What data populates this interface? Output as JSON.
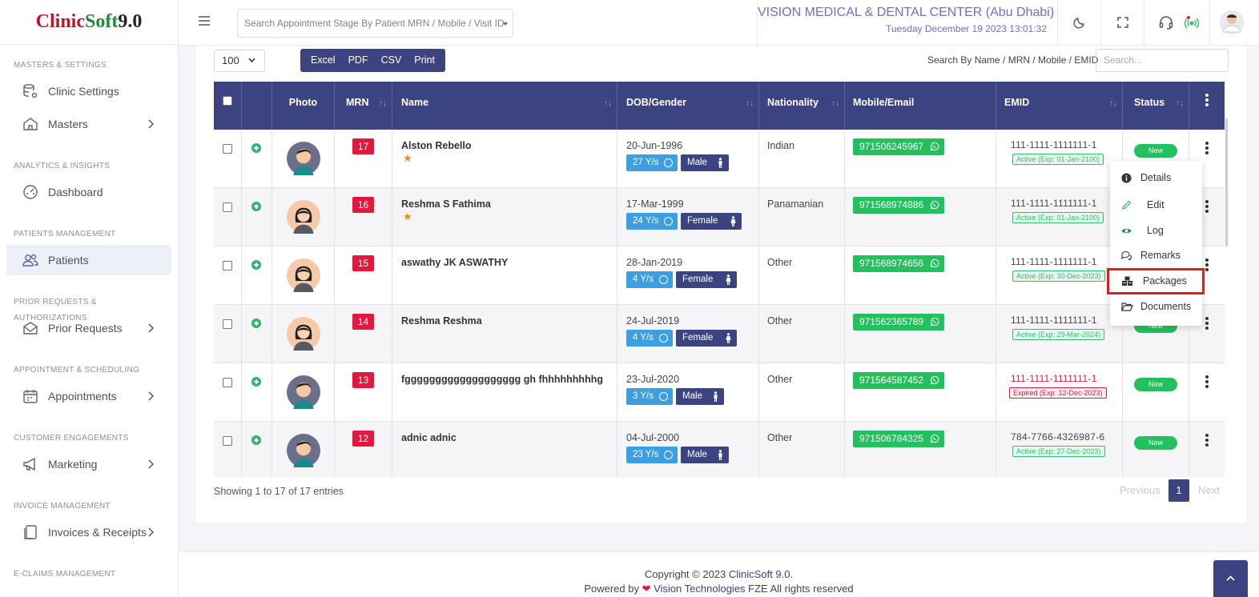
{
  "brand": {
    "part1": "Clinic",
    "part2": "Soft",
    "part3": " 9.0"
  },
  "sidebar": {
    "sections": [
      {
        "title": "MASTERS & SETTINGS",
        "items": [
          {
            "label": "Clinic Settings"
          },
          {
            "label": "Masters"
          }
        ]
      },
      {
        "title": "ANALYTICS & INSIGHTS",
        "items": [
          {
            "label": "Dashboard"
          }
        ]
      },
      {
        "title": "PATIENTS MANAGEMENT",
        "items": [
          {
            "label": "Patients"
          }
        ]
      },
      {
        "title": "PRIOR REQUESTS & AUTHORIZATIONS",
        "items": [
          {
            "label": "Prior Requests"
          }
        ]
      },
      {
        "title": "APPOINTMENT & SCHEDULING",
        "items": [
          {
            "label": "Appointments"
          }
        ]
      },
      {
        "title": "CUSTOMER ENGAGEMENTS",
        "items": [
          {
            "label": "Marketing"
          }
        ]
      },
      {
        "title": "INVOICE MANAGEMENT",
        "items": [
          {
            "label": "Invoices & Receipts"
          }
        ]
      },
      {
        "title": "E-CLAIMS MANAGEMENT",
        "items": []
      }
    ]
  },
  "header": {
    "search_placeholder": "Search Appointment Stage By Patient MRN / Mobile / Visit ID",
    "center_name": "VISION MEDICAL & DENTAL CENTER (Abu Dhabi)",
    "datetime": "Tuesday December 19 2023 13:01:32"
  },
  "toolbar": {
    "page_size": "100",
    "buttons": [
      "Excel",
      "PDF",
      "CSV",
      "Print"
    ],
    "search_label": "Search By Name / MRN / Mobile / EMID",
    "search_placeholder": "Search..."
  },
  "table": {
    "columns": [
      "Photo",
      "MRN",
      "Name",
      "DOB/Gender",
      "Nationality",
      "Mobile/Email",
      "EMID",
      "Status"
    ],
    "rows": [
      {
        "mrn": "17",
        "name": "Alston Rebello",
        "star": "★",
        "dob": "20-Jun-1996",
        "age": "27 Y/s",
        "gender": "Male",
        "nationality": "Indian",
        "mobile": "971506245967",
        "emid": "111-1111-1111111-1",
        "emid_status": "Active (Exp: 01-Jan-2100)",
        "status": "New"
      },
      {
        "mrn": "16",
        "name": "Reshma S Fathima",
        "star": "★",
        "dob": "17-Mar-1999",
        "age": "24 Y/s",
        "gender": "Female",
        "nationality": "Panamanian",
        "mobile": "971568974886",
        "emid": "111-1111-1111111-1",
        "emid_status": "Active (Exp: 01-Jan-2100)",
        "status": "New"
      },
      {
        "mrn": "15",
        "name": "aswathy JK ASWATHY",
        "star": "",
        "dob": "28-Jan-2019",
        "age": "4 Y/s",
        "gender": "Female",
        "nationality": "Other",
        "mobile": "971568974656",
        "emid": "111-1111-1111111-1",
        "emid_status": "Active (Exp: 30-Dec-2023)",
        "status": "New"
      },
      {
        "mrn": "14",
        "name": "Reshma Reshma",
        "star": "",
        "dob": "24-Jul-2019",
        "age": "4 Y/s",
        "gender": "Female",
        "nationality": "Other",
        "mobile": "971562365789",
        "emid": "111-1111-1111111-1",
        "emid_status": "Active (Exp: 29-Mar-2024)",
        "status": "New"
      },
      {
        "mrn": "13",
        "name": "fggggggggggggggggggg gh fhhhhhhhhhg",
        "star": "",
        "dob": "23-Jul-2020",
        "age": "3 Y/s",
        "gender": "Male",
        "nationality": "Other",
        "mobile": "971564587452",
        "emid": "111-1111-1111111-1",
        "emid_status": "Expired (Exp: 12-Dec-2023)",
        "status": "New"
      },
      {
        "mrn": "12",
        "name": "adnic adnic",
        "star": "",
        "dob": "04-Jul-2000",
        "age": "23 Y/s",
        "gender": "Male",
        "nationality": "Other",
        "mobile": "971506784325",
        "emid": "784-7766-4326987-6",
        "emid_status": "Active (Exp: 27-Dec-2023)",
        "status": "New"
      }
    ]
  },
  "dropdown": {
    "items": [
      "Details",
      "Edit",
      "Log",
      "Remarks",
      "Packages",
      "Documents"
    ]
  },
  "pagination": {
    "showing": "Showing 1 to 17 of 17 entries",
    "previous": "Previous",
    "page": "1",
    "next": "Next"
  },
  "footer": {
    "copyright_prefix": "Copyright © 2023 ",
    "copyright_brand": "ClinicSoft 9.0.",
    "powered_prefix": "Powered by ",
    "heart": "❤",
    "powered_brand": " Vision Technologies FZE",
    "powered_suffix": " All rights reserved"
  },
  "colors": {
    "primary": "#3b4381",
    "success": "#22c15e",
    "danger": "#e5173f",
    "accent": "#7669cf"
  }
}
